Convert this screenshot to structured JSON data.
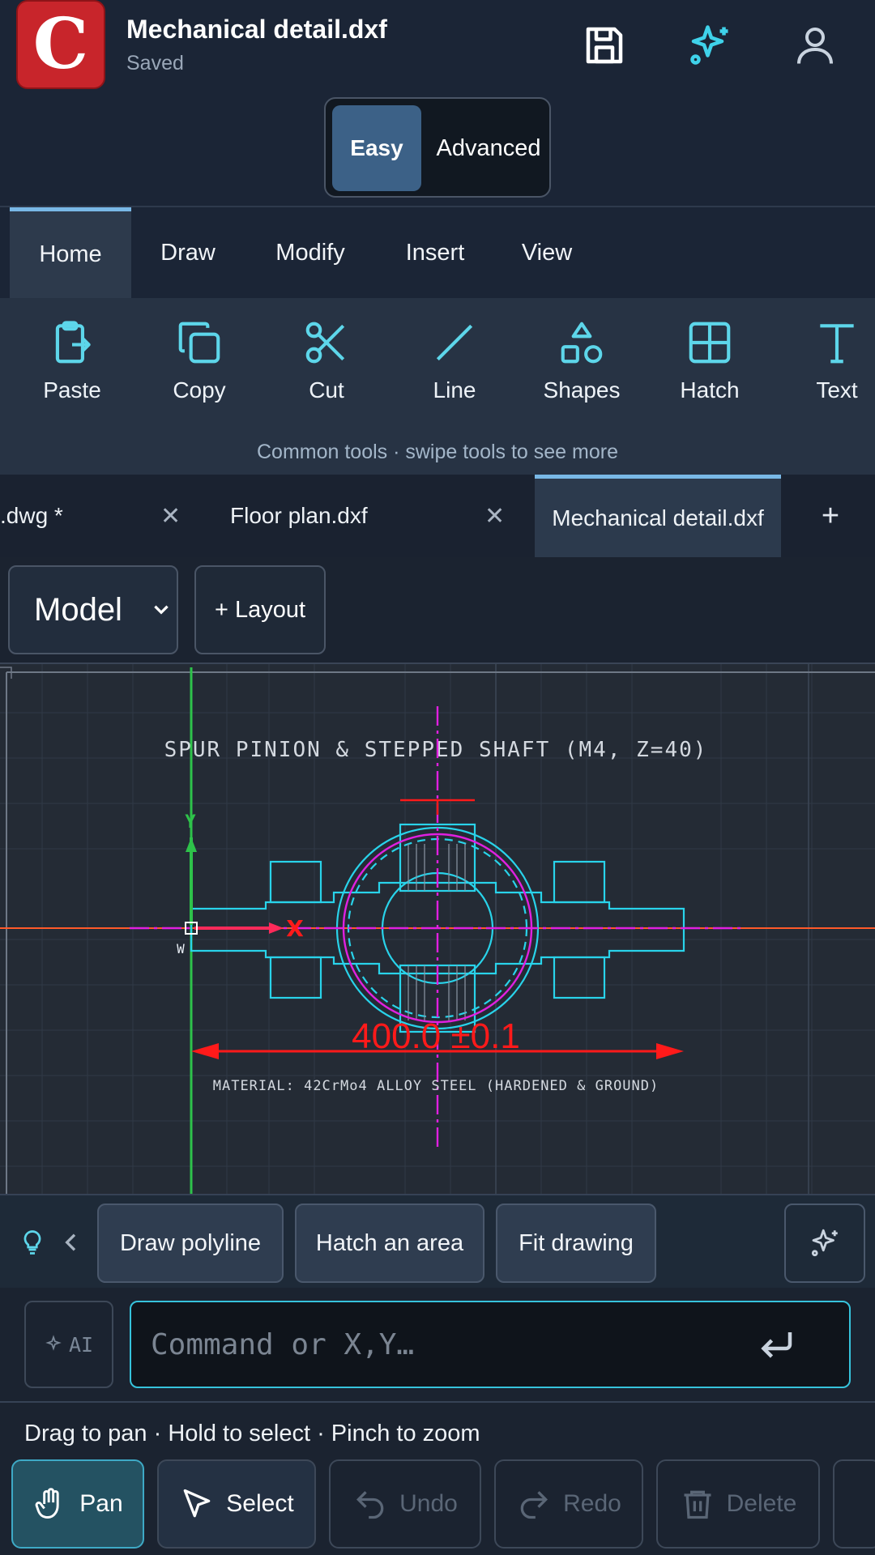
{
  "header": {
    "logo_letter": "C",
    "doc_title": "Mechanical detail.dxf",
    "doc_status": "Saved",
    "mode": {
      "easy": "Easy",
      "advanced": "Advanced",
      "active": "easy"
    }
  },
  "ribbon": {
    "tabs": [
      {
        "label": "Home",
        "active": true
      },
      {
        "label": "Draw"
      },
      {
        "label": "Modify"
      },
      {
        "label": "Insert"
      },
      {
        "label": "View"
      }
    ],
    "tools": [
      {
        "label": "Paste",
        "icon": "paste-icon"
      },
      {
        "label": "Copy",
        "icon": "copy-icon"
      },
      {
        "label": "Cut",
        "icon": "scissors-icon"
      },
      {
        "label": "Line",
        "icon": "line-icon"
      },
      {
        "label": "Shapes",
        "icon": "shapes-icon"
      },
      {
        "label": "Hatch",
        "icon": "grid-icon"
      },
      {
        "label": "Text",
        "icon": "text-icon"
      }
    ],
    "hint": "Common tools · swipe tools to see more"
  },
  "doc_tabs": [
    {
      "label": ".dwg *",
      "closable": true
    },
    {
      "label": "Floor plan.dxf",
      "closable": true
    },
    {
      "label": "Mechanical detail.dxf",
      "active": true
    },
    {
      "label": "+"
    }
  ],
  "layout": {
    "model_label": "Model",
    "add_layout_label": "+ Layout"
  },
  "drawing": {
    "title": "SPUR PINION & STEPPED SHAFT (M4, Z=40)",
    "dimension": "400.0 ±0.1",
    "material_note": "MATERIAL: 42CrMo4 ALLOY STEEL (HARDENED & GROUND)",
    "ucs_y": "Y",
    "ucs_x": "X",
    "ucs_w": "W",
    "colors": {
      "geometry": "#29d3ea",
      "centerline": "#e020e0",
      "dimension": "#ff1a1a",
      "axis_y": "#2ec24a",
      "axis_x": "#ff5a2a"
    }
  },
  "suggestions": [
    "Draw polyline",
    "Hatch an area",
    "Fit drawing"
  ],
  "command": {
    "ai_label": "AI",
    "placeholder": "Command or X,Y…"
  },
  "bottom": {
    "hint": "Drag to pan · Hold to select · Pinch to zoom",
    "buttons": [
      {
        "label": "Pan",
        "icon": "hand-icon",
        "active": true
      },
      {
        "label": "Select",
        "icon": "cursor-icon"
      },
      {
        "label": "Undo",
        "icon": "undo-icon",
        "disabled": true
      },
      {
        "label": "Redo",
        "icon": "redo-icon",
        "disabled": true
      },
      {
        "label": "Delete",
        "icon": "trash-icon",
        "disabled": true
      }
    ]
  }
}
